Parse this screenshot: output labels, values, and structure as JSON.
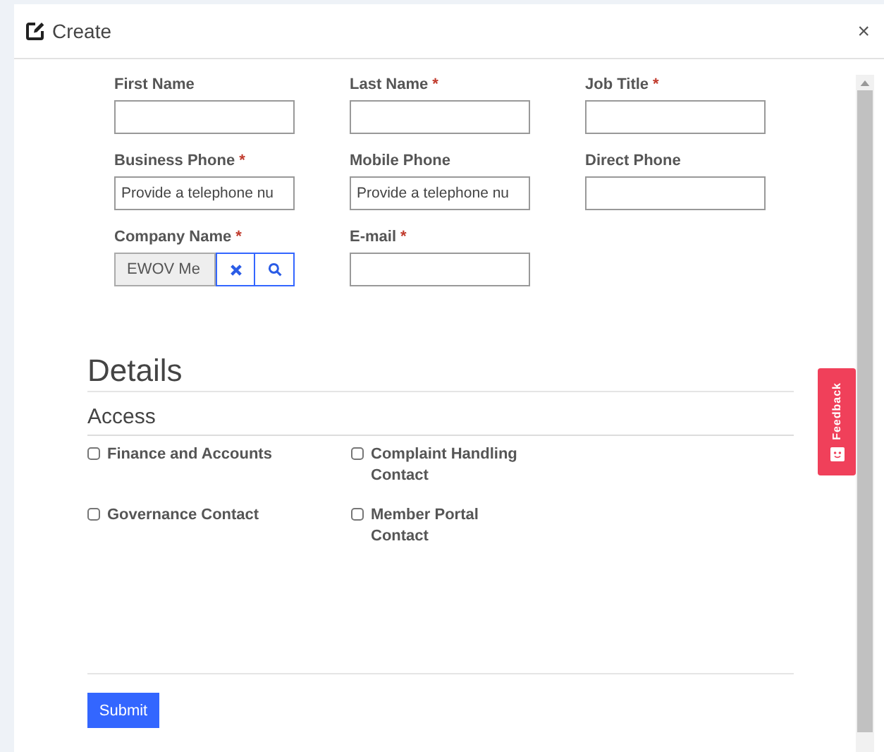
{
  "window": {
    "title": "Create",
    "close": "×"
  },
  "fields": [
    {
      "label": "First Name",
      "required": false,
      "kind": "text"
    },
    {
      "label": "Last Name",
      "required": true,
      "kind": "text"
    },
    {
      "label": "Job Title",
      "required": true,
      "kind": "text"
    },
    {
      "label": "Business Phone",
      "required": true,
      "kind": "text",
      "placeholder": "Provide a telephone nu"
    },
    {
      "label": "Mobile Phone",
      "required": false,
      "kind": "text",
      "placeholder": "Provide a telephone nu"
    },
    {
      "label": "Direct Phone",
      "required": false,
      "kind": "text"
    },
    {
      "label": "Company Name",
      "required": true,
      "kind": "lookup",
      "value": "EWOV Me"
    },
    {
      "label": "E-mail",
      "required": true,
      "kind": "text"
    }
  ],
  "details": {
    "title": "Details",
    "section": "Access",
    "options": [
      {
        "label": "Finance and Accounts",
        "checked": false
      },
      {
        "label": "Complaint Handling Contact",
        "checked": false
      },
      {
        "label": "Governance Contact",
        "checked": false
      },
      {
        "label": "Member Portal Contact",
        "checked": false
      }
    ]
  },
  "required_mark": "*",
  "submit": "Submit",
  "feedback": "Feedback"
}
